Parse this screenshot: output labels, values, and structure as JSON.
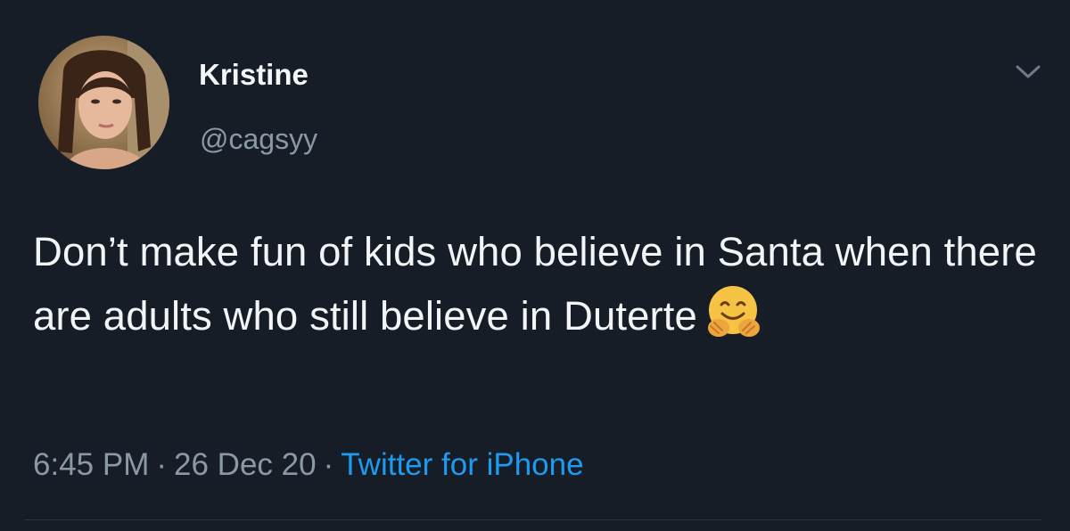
{
  "tweet": {
    "author": {
      "display_name": "Kristine",
      "handle": "@cagsyy"
    },
    "text_before_emoji": "Don’t make fun of kids who believe in Santa when there are adults who still believe in Duterte",
    "emoji": "hugging-face-emoji",
    "time": "6:45 PM",
    "separator": "·",
    "date": "26 Dec 20",
    "source": "Twitter for iPhone"
  },
  "colors": {
    "background": "#161d27",
    "primary_text": "#f2f4f6",
    "secondary_text": "#8b98a5",
    "link": "#1d9bf0"
  },
  "icons": {
    "menu": "chevron-down-icon"
  }
}
